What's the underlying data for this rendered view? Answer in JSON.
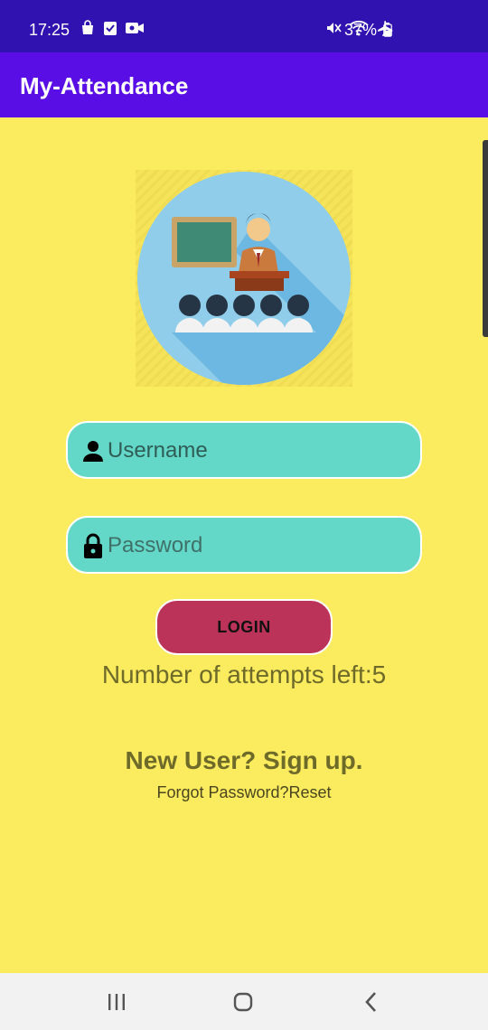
{
  "status_bar": {
    "time": "17:25",
    "left_icons": [
      "shopping-bag-icon",
      "checklist-icon",
      "video-call-icon"
    ],
    "right_icons": [
      "mute-icon",
      "wifi-icon",
      "airplane-mode-icon"
    ],
    "battery_percent": "37%"
  },
  "app_bar": {
    "title": "My-Attendance",
    "background": "#5a0ee6"
  },
  "logo": {
    "icon": "classroom-teacher-icon"
  },
  "form": {
    "username_placeholder": "Username",
    "username_icon": "person-icon",
    "password_placeholder": "Password",
    "password_icon": "lock-icon",
    "login_label": "LOGIN",
    "field_color": "#64d8c8",
    "button_color": "#bc3359"
  },
  "attempts_text": "Number of attempts left:5",
  "signup_text": "New User? Sign up.",
  "forgot_text": "Forgot Password?Reset",
  "nav_bar": {
    "items": [
      "recents-icon",
      "home-icon",
      "back-icon"
    ]
  },
  "colors": {
    "background": "#fbeb5e",
    "status_bar": "#2f12b0"
  }
}
